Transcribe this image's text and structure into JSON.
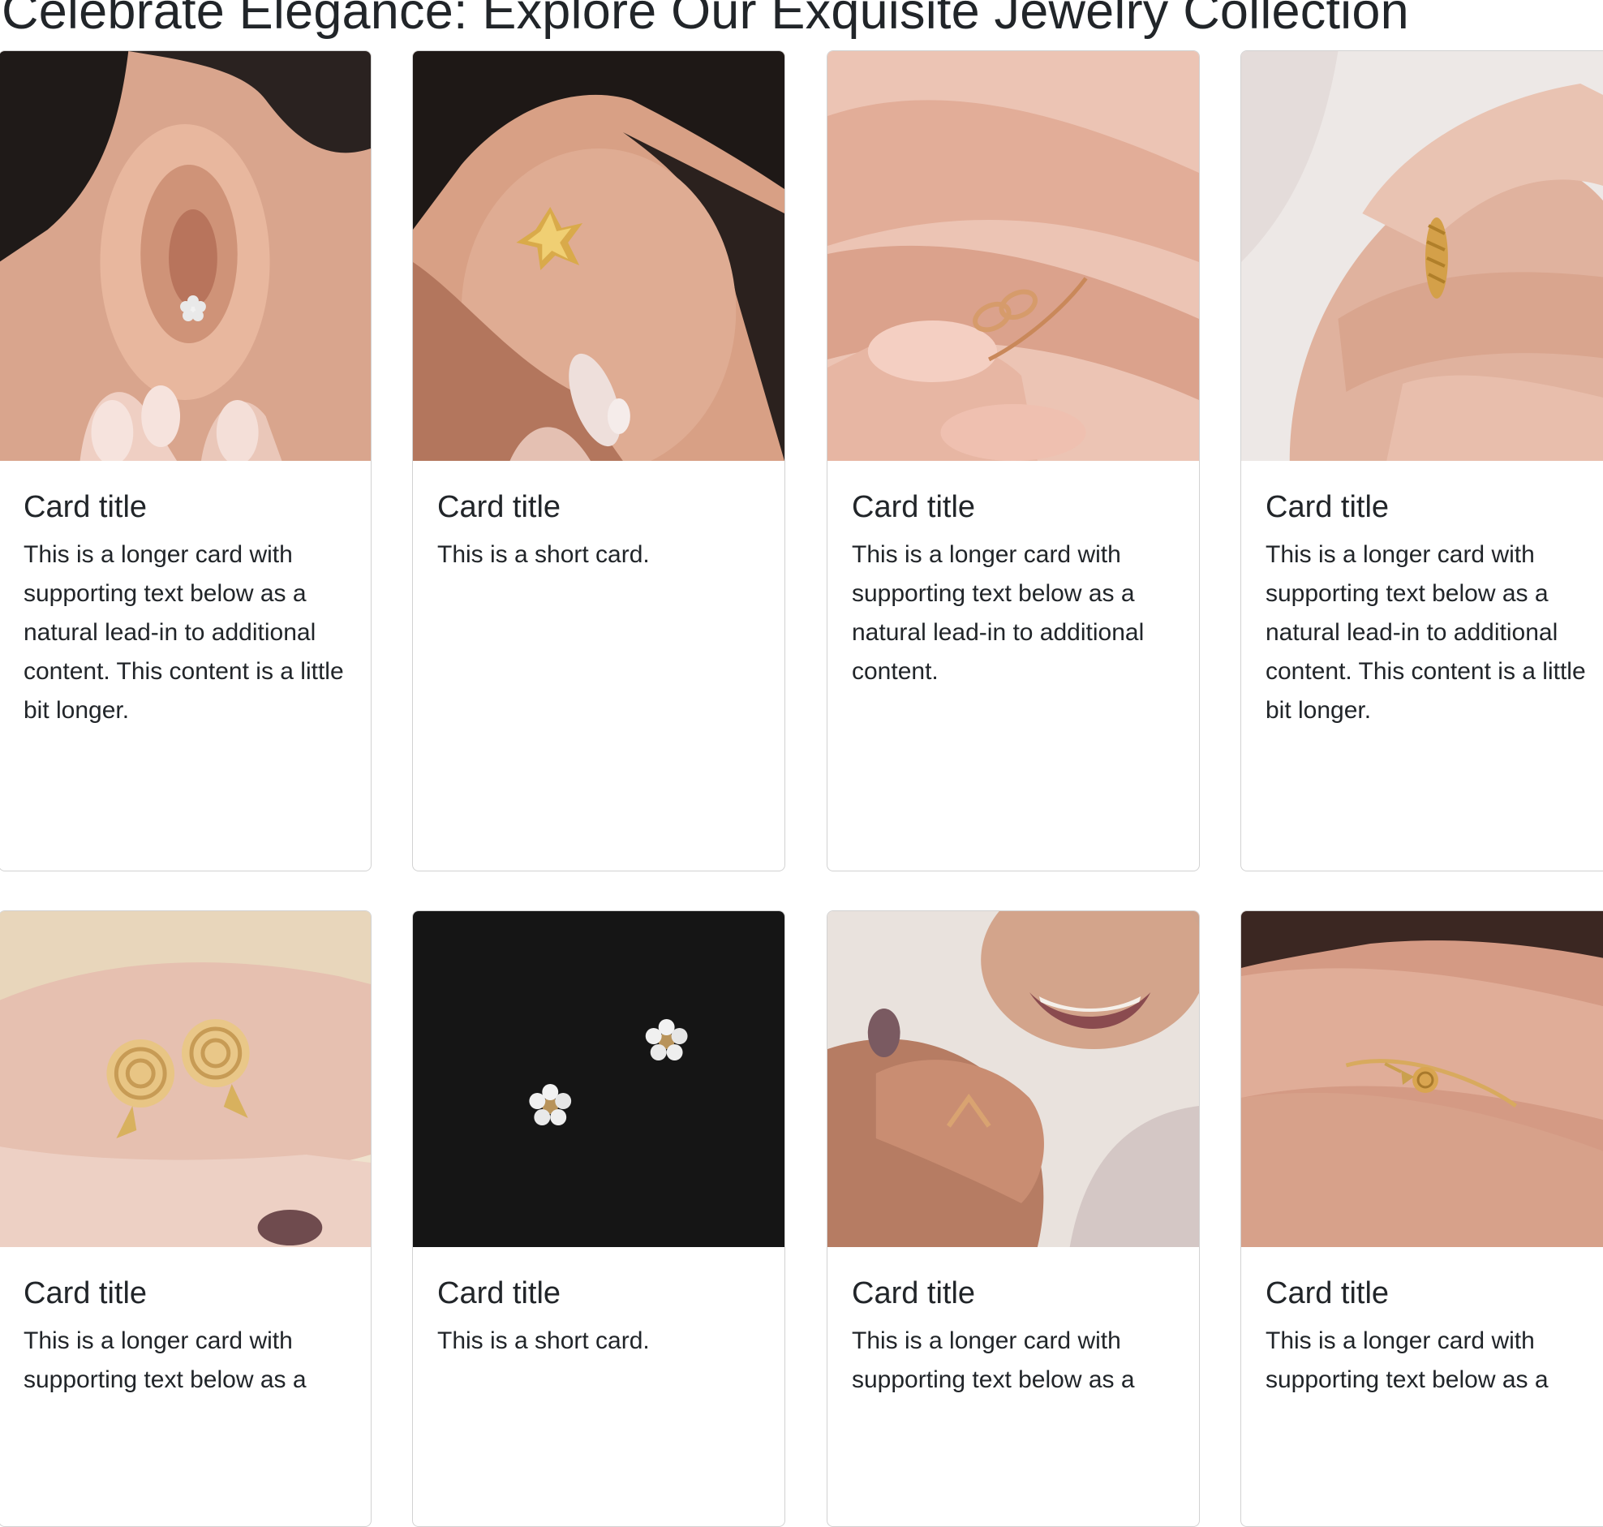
{
  "page": {
    "title": "Celebrate Elegance: Explore Our Exquisite Jewelry Collection"
  },
  "cards": [
    {
      "title": "Card title",
      "text": "This is a longer card with supporting text below as a natural lead-in to additional content. This content is a little bit longer.",
      "image": "ear-stud-flower-image"
    },
    {
      "title": "Card title",
      "text": "This is a short card.",
      "image": "ear-leaf-earring-image"
    },
    {
      "title": "Card title",
      "text": "This is a longer card with supporting text below as a natural lead-in to additional content.",
      "image": "infinity-ring-image"
    },
    {
      "title": "Card title",
      "text": "This is a longer card with supporting text below as a natural lead-in to additional content. This content is a little bit longer.",
      "image": "twisted-band-ring-image"
    },
    {
      "title": "Card title",
      "text": "This is a longer card with supporting text below as a",
      "image": "rose-earrings-image"
    },
    {
      "title": "Card title",
      "text": "This is a short card.",
      "image": "flower-studs-black-image"
    },
    {
      "title": "Card title",
      "text": "This is a longer card with supporting text below as a",
      "image": "chevron-ring-smile-image"
    },
    {
      "title": "Card title",
      "text": "This is a longer card with supporting text below as a",
      "image": "rose-ring-image"
    }
  ]
}
